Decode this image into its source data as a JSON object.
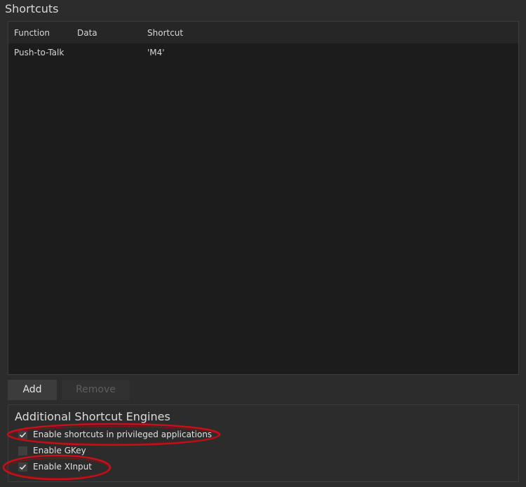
{
  "section": {
    "title": "Shortcuts"
  },
  "table": {
    "columns": [
      "Function",
      "Data",
      "Shortcut"
    ],
    "rows": [
      {
        "function": "Push-to-Talk",
        "data": "",
        "shortcut": "'M4'"
      }
    ]
  },
  "buttons": {
    "add": "Add",
    "remove": "Remove"
  },
  "engines": {
    "title": "Additional Shortcut Engines",
    "options": [
      {
        "label": "Enable shortcuts in privileged applications",
        "checked": true
      },
      {
        "label": "Enable GKey",
        "checked": false
      },
      {
        "label": "Enable XInput",
        "checked": true
      }
    ]
  },
  "colors": {
    "annotation": "#c8101a",
    "background": "#2c2c2c",
    "table_background": "#1c1c1c"
  },
  "icons": {
    "checkmark": "check-icon"
  }
}
